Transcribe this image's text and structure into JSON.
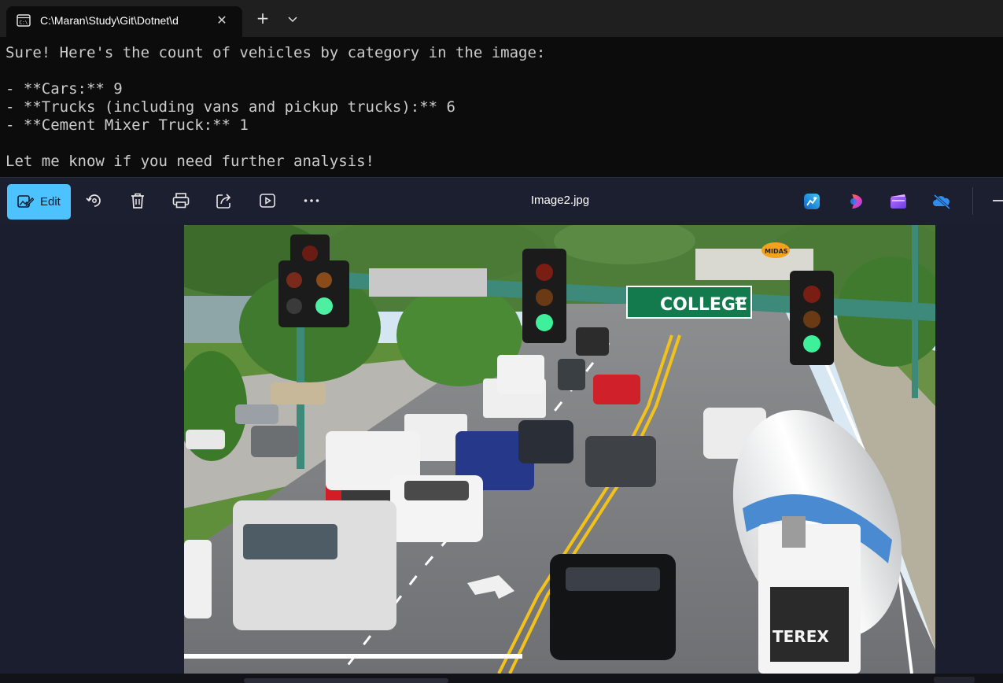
{
  "terminal": {
    "tab_title": "C:\\Maran\\Study\\Git\\Dotnet\\d",
    "lines": [
      "Sure! Here's the count of vehicles by category in the image:",
      "",
      "- **Cars:** 9",
      "- **Trucks (including vans and pickup trucks):** 6",
      "- **Cement Mixer Truck:** 1",
      "",
      "Let me know if you need further analysis!"
    ]
  },
  "photos": {
    "edit_label": "Edit",
    "file_name": "Image2.jpg",
    "toolbar_icons": [
      "rotate-icon",
      "delete-icon",
      "print-icon",
      "share-icon",
      "slideshow-icon",
      "more-icon"
    ],
    "app_icons": [
      "designer-icon",
      "clipchamp-color-icon",
      "clipchamp-icon",
      "onedrive-icon"
    ]
  },
  "photo_content": {
    "street_sign": "COLLEGE",
    "street_sign_suffix": "ST",
    "mixer_brand": "TEREX",
    "store_sign": "MIDAS"
  },
  "colors": {
    "accent": "#4cc2ff",
    "terminal_bg": "#0c0c0c",
    "photos_bg": "#1a1d2e"
  }
}
